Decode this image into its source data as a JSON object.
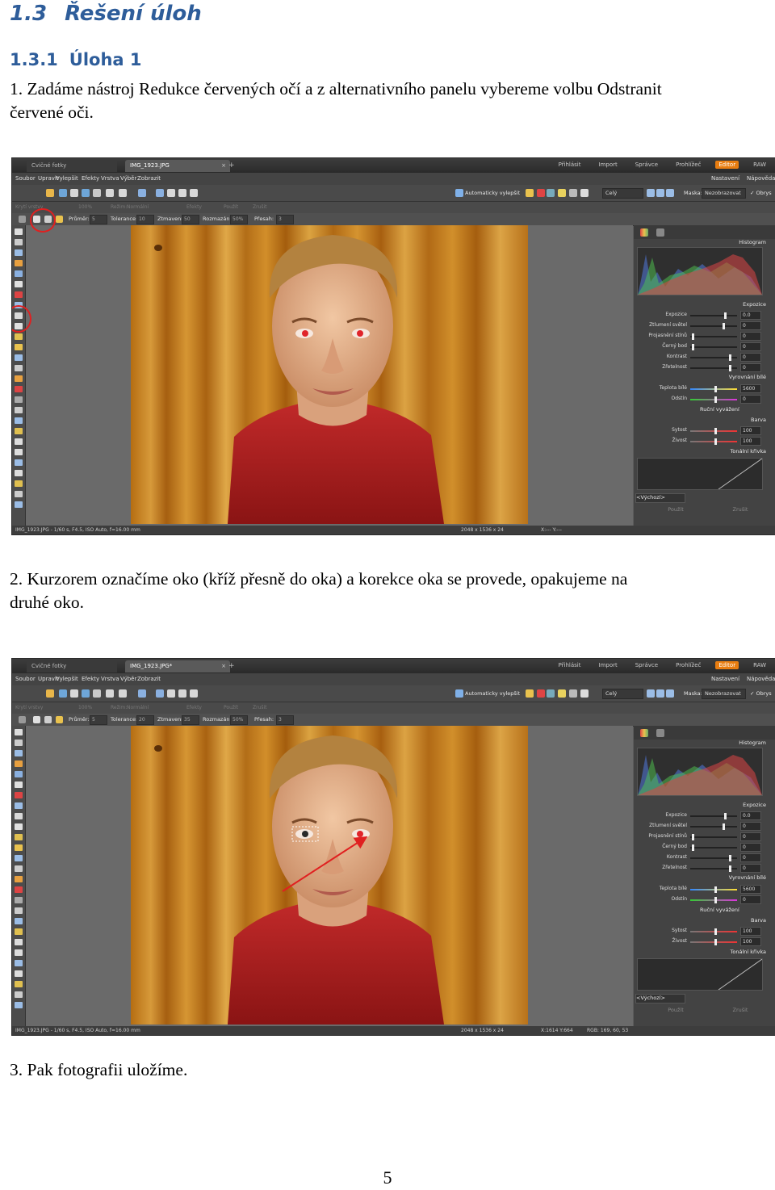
{
  "heading1": {
    "number": "1.3",
    "title": "Řešení úloh"
  },
  "heading2": {
    "number": "1.3.1",
    "title": "Úloha 1"
  },
  "step1": {
    "line1": "1. Zadáme nástroj Redukce červených očí a z alternativního panelu vybereme volbu Odstranit",
    "line2": "červené oči."
  },
  "step2": {
    "line1": "2. Kurzorem označíme oko (kříž přesně do oka) a korekce oka se provede, opakujeme na",
    "line2": "druhé oko."
  },
  "step3": {
    "text": "3. Pak fotografii uložíme."
  },
  "page_number": "5",
  "screenshot1": {
    "tab_inactive": "Cvičné fotky",
    "tab_active": "IMG_1923.JPG",
    "tab_close": "×",
    "new_tab": "+",
    "modes": [
      "Přihlásit",
      "Import",
      "Správce",
      "Prohlížeč",
      "Editor",
      "RAW"
    ],
    "menu": [
      "Soubor",
      "Upravit",
      "Vylepšit",
      "Efekty",
      "Vrstva",
      "Výběr",
      "Zobrazit"
    ],
    "menu_right": [
      "Nastavení",
      "Nápověda"
    ],
    "auto_enhance": "Automaticky vylepšit",
    "view_drop": "Celý",
    "mask_label": "Maska:",
    "mask_value": "Nezobrazovat",
    "frames_label": "Obrys",
    "tb2": [
      "Krytí vrstvy",
      "100%",
      "Režim:",
      "Normální",
      "Efekty",
      "Použít",
      "Zrušit"
    ],
    "options": {
      "size_label": "Průměr:",
      "size": "5",
      "tolerance_label": "Tolerance:",
      "tolerance": "10",
      "darken_label": "Ztmavení:",
      "darken": "50",
      "feather_label": "Rozmazání:",
      "feather": "50%",
      "threshold_label": "Přesah:",
      "threshold": "3"
    },
    "panel": {
      "histogram": "Histogram",
      "exposure_head": "Expozice",
      "sliders1": [
        {
          "label": "Expozice",
          "value": "0.0"
        },
        {
          "label": "Ztlumení světel",
          "value": "0"
        },
        {
          "label": "Projasnění stínů",
          "value": "0"
        },
        {
          "label": "Černý bod",
          "value": "0"
        },
        {
          "label": "Kontrast",
          "value": "0"
        },
        {
          "label": "Zřetelnost",
          "value": "0"
        }
      ],
      "wb_head": "Vyrovnání bílé",
      "sliders2": [
        {
          "label": "Teplota bílé",
          "value": "5600"
        },
        {
          "label": "Odstín",
          "value": "0"
        }
      ],
      "manual_wb": "Ruční vyvážení",
      "color_head": "Barva",
      "sliders3": [
        {
          "label": "Sytost",
          "value": "100"
        },
        {
          "label": "Živost",
          "value": "100"
        }
      ],
      "tone_head": "Tonální křivka",
      "preset": "<Výchozí>",
      "apply": "Použít",
      "cancel": "Zrušit"
    },
    "status_left": "IMG_1923.JPG - 1/60 s, F4.5, ISO Auto, f=16.00 mm",
    "status_mid": "2048 x 1536 x 24",
    "status_right": "X:--- Y:---",
    "status_rgb": ""
  },
  "screenshot2": {
    "tab_inactive": "Cvičné fotky",
    "tab_active": "IMG_1923.JPG*",
    "tab_close": "×",
    "new_tab": "+",
    "modes": [
      "Přihlásit",
      "Import",
      "Správce",
      "Prohlížeč",
      "Editor",
      "RAW"
    ],
    "menu": [
      "Soubor",
      "Upravit",
      "Vylepšit",
      "Efekty",
      "Vrstva",
      "Výběr",
      "Zobrazit"
    ],
    "menu_right": [
      "Nastavení",
      "Nápověda"
    ],
    "auto_enhance": "Automaticky vylepšit",
    "view_drop": "Celý",
    "mask_label": "Maska:",
    "mask_value": "Nezobrazovat",
    "frames_label": "Obrys",
    "tb2": [
      "Krytí vrstvy",
      "100%",
      "Režim:",
      "Normální",
      "Efekty",
      "Použít",
      "Zrušit"
    ],
    "options": {
      "size_label": "Průměr:",
      "size": "5",
      "tolerance_label": "Tolerance:",
      "tolerance": "20",
      "darken_label": "Ztmavení:",
      "darken": "35",
      "feather_label": "Rozmazání:",
      "feather": "50%",
      "threshold_label": "Přesah:",
      "threshold": "3"
    },
    "panel": {
      "histogram": "Histogram",
      "exposure_head": "Expozice",
      "sliders1": [
        {
          "label": "Expozice",
          "value": "0.0"
        },
        {
          "label": "Ztlumení světel",
          "value": "0"
        },
        {
          "label": "Projasnění stínů",
          "value": "0"
        },
        {
          "label": "Černý bod",
          "value": "0"
        },
        {
          "label": "Kontrast",
          "value": "0"
        },
        {
          "label": "Zřetelnost",
          "value": "0"
        }
      ],
      "wb_head": "Vyrovnání bílé",
      "sliders2": [
        {
          "label": "Teplota bílé",
          "value": "5600"
        },
        {
          "label": "Odstín",
          "value": "0"
        }
      ],
      "manual_wb": "Ruční vyvážení",
      "color_head": "Barva",
      "sliders3": [
        {
          "label": "Sytost",
          "value": "100"
        },
        {
          "label": "Živost",
          "value": "100"
        }
      ],
      "tone_head": "Tonální křivka",
      "preset": "<Výchozí>",
      "apply": "Použít",
      "cancel": "Zrušit"
    },
    "status_left": "IMG_1923.JPG - 1/60 s, F4.5, ISO Auto, f=16.00 mm",
    "status_mid": "2048 x 1536 x 24",
    "status_right": "X:1614 Y:664",
    "status_rgb": "RGB: 169, 60, 53"
  },
  "colors": {
    "heading": "#2e5d9a",
    "highlight_circle": "#e02020",
    "editor_tab": "#e87d10",
    "arrow": "#e02020"
  }
}
